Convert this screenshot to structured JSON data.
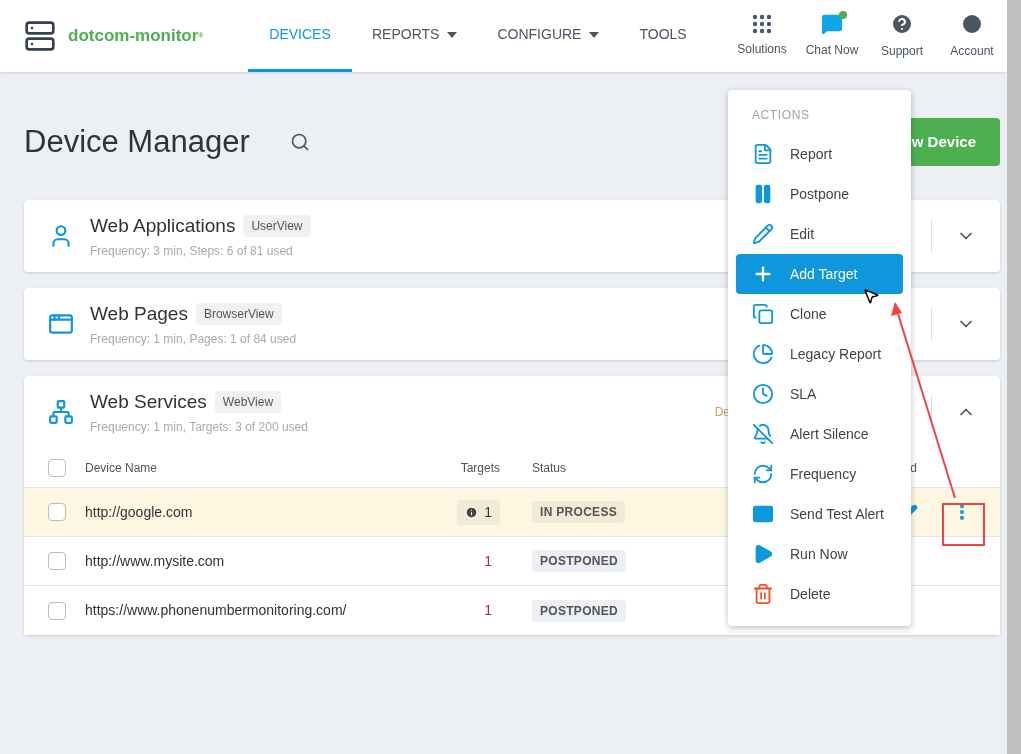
{
  "brand": {
    "name": "dotcom-monitor",
    "mark": "®"
  },
  "nav": [
    {
      "label": "DEVICES",
      "selected": true,
      "dropdown": false
    },
    {
      "label": "REPORTS",
      "selected": false,
      "dropdown": true
    },
    {
      "label": "CONFIGURE",
      "selected": false,
      "dropdown": true
    },
    {
      "label": "TOOLS",
      "selected": false,
      "dropdown": false
    }
  ],
  "header_links": [
    "Solutions",
    "Chat Now",
    "Support",
    "Account"
  ],
  "page_title": "Device Manager",
  "new_device_button": "w Device",
  "groups": [
    {
      "title": "Web Applications",
      "tag": "UserView",
      "summary": "Frequency: 3 min, Steps: 6 of 81 used",
      "expanded": false
    },
    {
      "title": "Web Pages",
      "tag": "BrowserView",
      "summary": "Frequency: 1 min, Pages: 1 of 84 used",
      "expanded": false
    },
    {
      "title": "Web Services",
      "tag": "WebView",
      "summary": "Frequency: 1 min, Targets: 3 of 200 used",
      "expanded": true,
      "column_right": "De",
      "table": {
        "select_all_checked": false,
        "columns": [
          "Device Name",
          "Targets",
          "Status",
          "d"
        ],
        "rows": [
          {
            "checked": false,
            "selected": true,
            "name": "http://google.com",
            "targets": "1",
            "info": true,
            "status": "IN PROCESS",
            "kind": "in_process"
          },
          {
            "checked": false,
            "selected": false,
            "name": "http://www.mysite.com",
            "targets": "1",
            "info": false,
            "status": "POSTPONED",
            "kind": "postponed"
          },
          {
            "checked": false,
            "selected": false,
            "name": "https://www.phonenumbermonitoring.com/",
            "targets": "1",
            "info": false,
            "status": "POSTPONED",
            "kind": "postponed"
          }
        ]
      }
    }
  ],
  "actions_menu": {
    "heading": "ACTIONS",
    "items": [
      {
        "label": "Report",
        "selected": false
      },
      {
        "label": "Postpone",
        "selected": false
      },
      {
        "label": "Edit",
        "selected": false
      },
      {
        "label": "Add Target",
        "selected": true
      },
      {
        "label": "Clone",
        "selected": false
      },
      {
        "label": "Legacy Report",
        "selected": false
      },
      {
        "label": "SLA",
        "selected": false
      },
      {
        "label": "Alert Silence",
        "selected": false
      },
      {
        "label": "Frequency",
        "selected": false
      },
      {
        "label": "Send Test Alert",
        "selected": false
      },
      {
        "label": "Run Now",
        "selected": false
      },
      {
        "label": "Delete",
        "selected": false
      }
    ]
  }
}
